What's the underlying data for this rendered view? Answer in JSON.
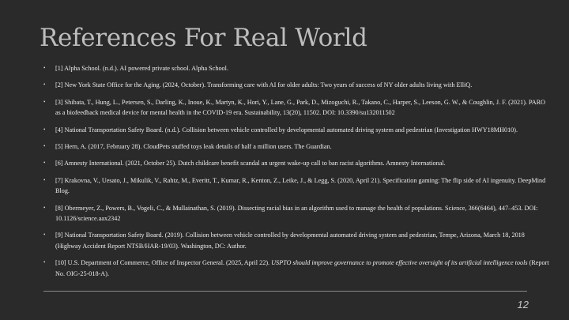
{
  "slide": {
    "title": "References For Real World",
    "page_number": "12",
    "bullet_glyph": "•",
    "colors": {
      "background": "#2a2a2a",
      "title": "#bdbdbd",
      "text": "#ededed",
      "divider": "#8a8a8a"
    }
  },
  "references": [
    {
      "text": "[1] Alpha School. (n.d.). AI powered private school. Alpha School."
    },
    {
      "text": "[2] New York State Office for the Aging. (2024, October). Transforming care with AI for older adults: Two years of success of NY older adults living with ElliQ."
    },
    {
      "text": "[3] Shibata, T., Hung, L., Petersen, S., Darling, K., Inoue, K., Martyn, K., Hori, Y., Lane, G., Park, D., Mizoguchi, R., Takano, C., Harper, S., Leeson, G. W., & Coughlin, J. F. (2021). PARO as a biofeedback medical device for mental health in the COVID-19 era. Sustainability, 13(20), 11502. DOI: 10.3390/su132011502"
    },
    {
      "text": "[4] National Transportation Safety Board. (n.d.). Collision between vehicle controlled by developmental automated driving system and pedestrian (Investigation HWY18MH010)."
    },
    {
      "text": "[5] Hern, A. (2017, February 28). CloudPets stuffed toys leak details of half a million users. The Guardian."
    },
    {
      "text": "[6] Amnesty International. (2021, October 25). Dutch childcare benefit scandal an urgent wake-up call to ban racist algorithms. Amnesty International."
    },
    {
      "text": "[7] Krakovna, V., Uesato, J., Mikulik, V., Rahtz, M., Everitt, T., Kumar, R., Kenton, Z., Leike, J., & Legg, S. (2020, April 21). Specification gaming: The flip side of AI ingenuity. DeepMind Blog."
    },
    {
      "text": "[8] Obermeyer, Z., Powers, B., Vogeli, C., & Mullainathan, S. (2019). Dissecting racial bias in an algorithm used to manage the health of populations. Science, 366(6464), 447–453. DOI: 10.1126/science.aax2342"
    },
    {
      "text": "[9] National Transportation Safety Board. (2019). Collision between vehicle controlled by developmental automated driving system and pedestrian, Tempe, Arizona, March 18, 2018 (Highway Accident Report NTSB/HAR-19/03). Washington, DC: Author."
    },
    {
      "text_before": "[10] U.S. Department of Commerce, Office of Inspector General. (2025, April 22). ",
      "text_italic": "USPTO should improve governance to promote effective oversight of its artificial intelligence tools",
      "text_after": " (Report No. OIG-25-018-A)."
    }
  ]
}
